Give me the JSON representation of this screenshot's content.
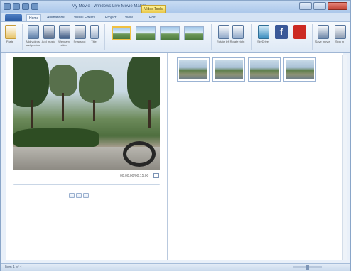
{
  "app": {
    "title": "My Movie - Windows Live Movie Maker"
  },
  "tools_badge": "Video Tools",
  "tabs": [
    {
      "label": "Home",
      "active": true
    },
    {
      "label": "Animations"
    },
    {
      "label": "Visual Effects"
    },
    {
      "label": "Project"
    },
    {
      "label": "View"
    },
    {
      "label": "Edit"
    }
  ],
  "file_tab": "",
  "ribbon": {
    "buttons": [
      {
        "label": "Paste",
        "icon": "paste-icon"
      },
      {
        "label": "Add videos and photos",
        "icon": "add-videos-icon"
      },
      {
        "label": "Add music",
        "icon": "add-music-icon"
      },
      {
        "label": "Webcam video",
        "icon": "webcam-icon"
      },
      {
        "label": "Snapshot",
        "icon": "snapshot-icon"
      },
      {
        "label": "Title",
        "icon": "title-icon"
      }
    ],
    "theme_count": 4,
    "right_buttons": [
      {
        "label": "Rotate left",
        "icon": "rotate-left-icon"
      },
      {
        "label": "Rotate right",
        "icon": "rotate-right-icon"
      },
      {
        "label": "SkyDrive",
        "icon": "skydrive-icon"
      },
      {
        "label": "Facebook",
        "icon": "facebook-icon",
        "color": "#3b5998"
      },
      {
        "label": "YouTube",
        "icon": "youtube-icon",
        "color": "#cc2a22"
      },
      {
        "label": "Save movie",
        "icon": "save-movie-icon"
      },
      {
        "label": "Sign in",
        "icon": "sign-in-icon"
      }
    ]
  },
  "player": {
    "timecode": "00:00.00/00:15.00"
  },
  "storyboard": {
    "clip_count": 4
  },
  "status": {
    "text": "Item 1 of 4"
  }
}
